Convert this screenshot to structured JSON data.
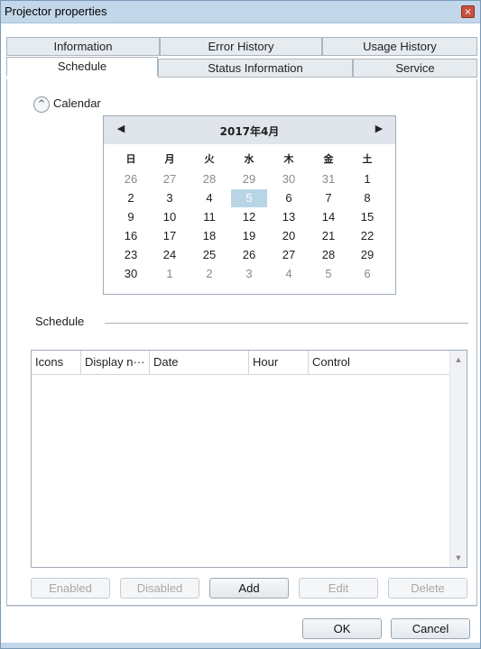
{
  "window": {
    "title": "Projector properties",
    "close_glyph": "×"
  },
  "tabs_row1": [
    {
      "label": "Information"
    },
    {
      "label": "Error History"
    },
    {
      "label": "Usage History"
    }
  ],
  "tabs_row2": [
    {
      "label": "Schedule",
      "active": true
    },
    {
      "label": "Status Information"
    },
    {
      "label": "Service"
    }
  ],
  "calendar_section": {
    "label": "Calendar",
    "toggle_icon": "chevron-up-icon",
    "toggle_glyph": "^",
    "month_title": "2017年4月",
    "prev_glyph": "◀",
    "next_glyph": "▶",
    "weekdays": [
      "日",
      "月",
      "火",
      "水",
      "木",
      "金",
      "土"
    ],
    "weeks": [
      [
        "26",
        "27",
        "28",
        "29",
        "30",
        "31",
        "1"
      ],
      [
        "2",
        "3",
        "4",
        "5",
        "6",
        "7",
        "8"
      ],
      [
        "9",
        "10",
        "11",
        "12",
        "13",
        "14",
        "15"
      ],
      [
        "16",
        "17",
        "18",
        "19",
        "20",
        "21",
        "22"
      ],
      [
        "23",
        "24",
        "25",
        "26",
        "27",
        "28",
        "29"
      ],
      [
        "30",
        "1",
        "2",
        "3",
        "4",
        "5",
        "6"
      ]
    ],
    "selected_day": "5"
  },
  "schedule": {
    "label": "Schedule",
    "columns": [
      "Icons",
      "Display n···",
      "Date",
      "Hour",
      "Control"
    ],
    "rows": [],
    "scroll_up_glyph": "▲",
    "scroll_down_glyph": "▼"
  },
  "buttons": {
    "enabled": "Enabled",
    "disabled": "Disabled",
    "add": "Add",
    "edit": "Edit",
    "delete": "Delete"
  },
  "dialog_buttons": {
    "ok": "OK",
    "cancel": "Cancel"
  },
  "colors": {
    "titlebar": "#c3d7ea",
    "selected_day": "#b8d5e6",
    "close_button": "#c9523f"
  }
}
